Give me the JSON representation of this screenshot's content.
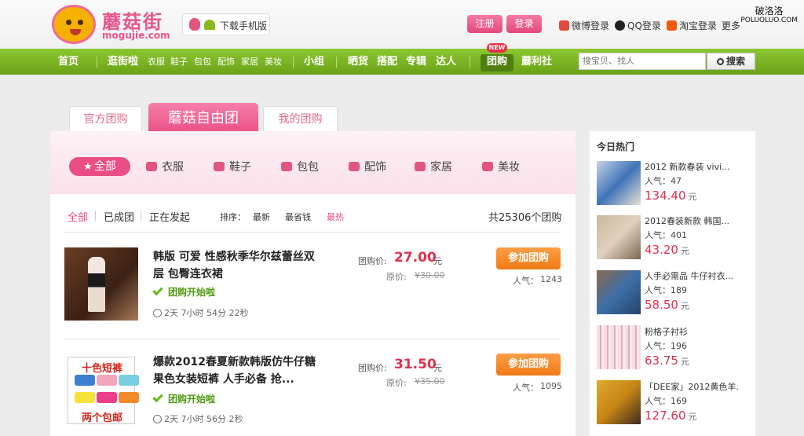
{
  "header": {
    "brand": "蘑菇街",
    "brand_url": "mogujie.com",
    "mobile_download": "下载手机版",
    "register": "注册",
    "login": "登录",
    "weibo_login": "微博登录",
    "qq_login": "QQ登录",
    "taobao_login": "淘宝登录",
    "more": "更多"
  },
  "watermark": {
    "line1": "破洛洛",
    "line2": "POLUOLUO.COM"
  },
  "nav": {
    "home": "首页",
    "browse": "逛街啦",
    "sub": [
      "衣服",
      "鞋子",
      "包包",
      "配饰",
      "家居",
      "美妆"
    ],
    "group": "小组",
    "show": "晒货",
    "match": "搭配",
    "album": "专辑",
    "expert": "达人",
    "tuan": "团购",
    "new_badge": "NEW",
    "welfare": "蘑利社",
    "search_placeholder": "搜宝贝、找人",
    "search_btn": "搜索"
  },
  "tabs": {
    "official": "官方团购",
    "free": "蘑菇自由团",
    "mine": "我的团购"
  },
  "categories": {
    "all": "全部",
    "items": [
      "衣服",
      "鞋子",
      "包包",
      "配饰",
      "家居",
      "美妆"
    ]
  },
  "filters": {
    "all": "全部",
    "done": "已成团",
    "ongoing": "正在发起",
    "sort_label": "排序：",
    "newest": "最新",
    "cheapest": "最省钱",
    "hottest": "最热",
    "total": "共25306个团购"
  },
  "deals": [
    {
      "title": "韩版 可爱 性感秋季华尔兹蕾丝双层 包臀连衣裙",
      "status": "团购开始啦",
      "time": "2天 7小时 54分 22秒",
      "price_label": "团购价:",
      "price": "27.00",
      "unit": "元",
      "orig_label": "原价:",
      "orig": "¥30.00",
      "join": "参加团购",
      "pop_label": "人气：",
      "pop": "1243"
    },
    {
      "title": "爆款2012春夏新款韩版仿牛仔糖果色女装短裤 人手必备 抢...",
      "status": "团购开始啦",
      "time": "2天 7小时 56分 2秒",
      "price_label": "团购价:",
      "price": "31.50",
      "unit": "元",
      "orig_label": "原价:",
      "orig": "¥35.00",
      "join": "参加团购",
      "pop_label": "人气：",
      "pop": "1095",
      "thumb_title": "十色短裤",
      "thumb_foot": "两个包邮"
    }
  ],
  "hot": {
    "title": "今日热门",
    "pop_label": "人气：",
    "unit": "元",
    "items": [
      {
        "name": "2012 新款春装 vivi...",
        "pop": "47",
        "price": "134.40"
      },
      {
        "name": "2012春装新款 韩国...",
        "pop": "401",
        "price": "43.20"
      },
      {
        "name": "人手必需品 牛仔衬衣...",
        "pop": "189",
        "price": "58.50"
      },
      {
        "name": "粉格子衬衫",
        "pop": "196",
        "price": "63.75"
      },
      {
        "name": "「DEE家」2012黄色羊...",
        "pop": "169",
        "price": "127.60"
      }
    ]
  }
}
